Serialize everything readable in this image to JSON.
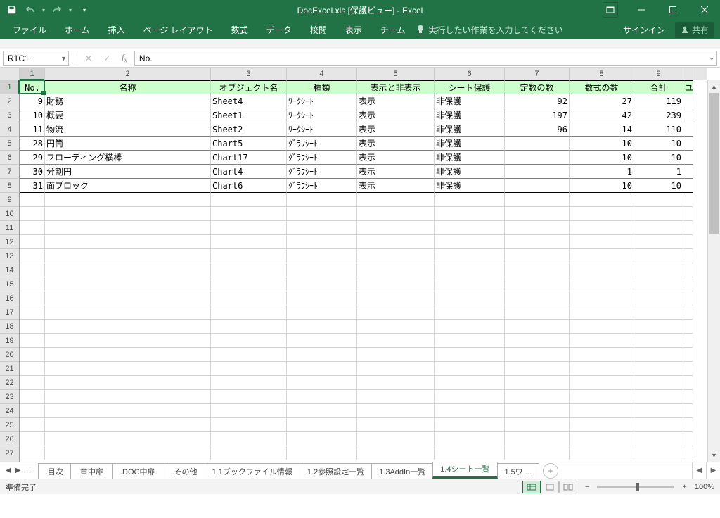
{
  "title": "DocExcel.xls  [保護ビュー] - Excel",
  "ribbon": {
    "file": "ファイル",
    "home": "ホーム",
    "insert": "挿入",
    "layout": "ページ レイアウト",
    "formula": "数式",
    "data": "データ",
    "review": "校閲",
    "view": "表示",
    "team": "チーム",
    "tellme": "実行したい作業を入力してください",
    "signin": "サインイン",
    "share": "共有"
  },
  "namebox": "R1C1",
  "formula": "No.",
  "cols": [
    "1",
    "2",
    "3",
    "4",
    "5",
    "6",
    "7",
    "8",
    "9"
  ],
  "headers": {
    "c1": "No.",
    "c2": "名称",
    "c3": "オブジェクト名",
    "c4": "種類",
    "c5": "表示と非表示",
    "c6": "シート保護",
    "c7": "定数の数",
    "c8": "数式の数",
    "c9": "合計",
    "c10": "ユ"
  },
  "data": [
    {
      "no": "9",
      "name": "財務",
      "obj": "Sheet4",
      "kind": "ﾜｰｸｼｰﾄ",
      "disp": "表示",
      "prot": "非保護",
      "const": "92",
      "fx": "27",
      "sum": "119"
    },
    {
      "no": "10",
      "name": "概要",
      "obj": "Sheet1",
      "kind": "ﾜｰｸｼｰﾄ",
      "disp": "表示",
      "prot": "非保護",
      "const": "197",
      "fx": "42",
      "sum": "239"
    },
    {
      "no": "11",
      "name": "物流",
      "obj": "Sheet2",
      "kind": "ﾜｰｸｼｰﾄ",
      "disp": "表示",
      "prot": "非保護",
      "const": "96",
      "fx": "14",
      "sum": "110"
    },
    {
      "no": "28",
      "name": "円筒",
      "obj": "Chart5",
      "kind": "ｸﾞﾗﾌｼｰﾄ",
      "disp": "表示",
      "prot": "非保護",
      "const": "",
      "fx": "10",
      "sum": "10"
    },
    {
      "no": "29",
      "name": "フローティング横棒",
      "obj": "Chart17",
      "kind": "ｸﾞﾗﾌｼｰﾄ",
      "disp": "表示",
      "prot": "非保護",
      "const": "",
      "fx": "10",
      "sum": "10"
    },
    {
      "no": "30",
      "name": "分割円",
      "obj": "Chart4",
      "kind": "ｸﾞﾗﾌｼｰﾄ",
      "disp": "表示",
      "prot": "非保護",
      "const": "",
      "fx": "1",
      "sum": "1"
    },
    {
      "no": "31",
      "name": "面ブロック",
      "obj": "Chart6",
      "kind": "ｸﾞﾗﾌｼｰﾄ",
      "disp": "表示",
      "prot": "非保護",
      "const": "",
      "fx": "10",
      "sum": "10"
    }
  ],
  "rowcount": 27,
  "tabs": {
    "nav": "...",
    "t1": ".目次",
    "t2": ".章中扉.",
    "t3": ".DOC中扉.",
    "t4": ".その他",
    "t5": "1.1ブックファイル情報",
    "t6": "1.2参照設定一覧",
    "t7": "1.3AddIn一覧",
    "t8": "1.4シート一覧",
    "t9": "1.5ワ ..."
  },
  "status": {
    "ready": "準備完了",
    "zoom": "100%"
  }
}
